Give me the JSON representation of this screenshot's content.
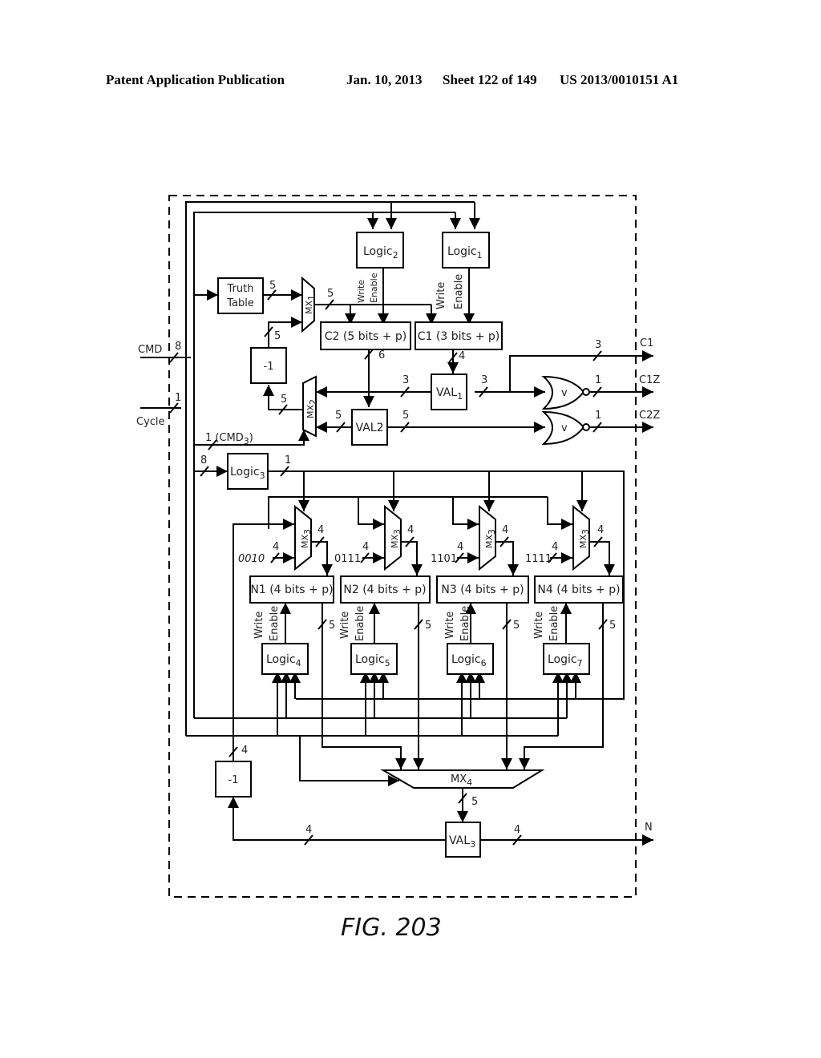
{
  "header": {
    "publication": "Patent Application Publication",
    "date": "Jan. 10, 2013",
    "sheet": "Sheet 122 of 149",
    "number": "US 2013/0010151 A1"
  },
  "figure": {
    "caption": "FIG. 203"
  },
  "blocks": {
    "logic1": "Logic",
    "logic1_sub": "1",
    "logic2": "Logic",
    "logic2_sub": "2",
    "logic3": "Logic",
    "logic3_sub": "3",
    "logic4": "Logic",
    "logic4_sub": "4",
    "logic5": "Logic",
    "logic5_sub": "5",
    "logic6": "Logic",
    "logic6_sub": "6",
    "logic7": "Logic",
    "logic7_sub": "7",
    "truth_table_line1": "Truth",
    "truth_table_line2": "Table",
    "c2": "C2 (5 bits + p)",
    "c1": "C1 (3 bits + p)",
    "dec1": "-1",
    "dec2": "-1",
    "val1": "VAL",
    "val1_sub": "1",
    "val2": "VAL2",
    "val3": "VAL",
    "val3_sub": "3",
    "n1": "N1 (4 bits + p)",
    "n2": "N2 (4 bits + p)",
    "n3": "N3 (4 bits + p)",
    "n4": "N4 (4 bits + p)",
    "mx1": "MX",
    "mx1_sub": "1",
    "mx2": "MX",
    "mx2_sub": "2",
    "mx3": "MX",
    "mx3_sub": "3",
    "mx4": "MX",
    "mx4_sub": "4",
    "nor_symbol": "v"
  },
  "signals": {
    "cmd": "CMD",
    "cycle": "Cycle",
    "cmd3": "1 (CMD",
    "cmd3_sub": "3",
    "cmd3_close": ")",
    "c1_out": "C1",
    "c1z_out": "C1Z",
    "c2z_out": "C2Z",
    "n_out": "N",
    "write": "Write",
    "enable": "Enable",
    "const_n1": "0010",
    "const_n2": "0111",
    "const_n3": "1101",
    "const_n4": "1111"
  },
  "widths": {
    "cmd": "8",
    "cycle": "1",
    "tt_out": "5",
    "mx1_out": "5",
    "dec1_out": "5",
    "mx2_out": "5",
    "c2_out": "6",
    "c1_out": "4",
    "val1_in": "3",
    "val1_out": "3",
    "c1_bus": "3",
    "val2_in": "5",
    "val2_out": "5",
    "c1z": "1",
    "c2z": "1",
    "logic3_in": "8",
    "logic3_out": "1",
    "const": "4",
    "mx3_out": "4",
    "n_out": "5",
    "dec2_in": "4",
    "mx4_out": "5",
    "val3_left": "4",
    "val3_right": "4"
  }
}
